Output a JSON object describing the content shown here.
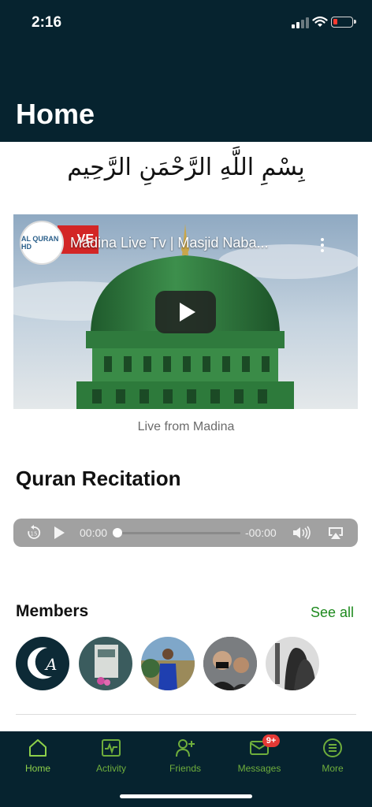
{
  "status_bar": {
    "time": "2:16",
    "battery_color": "#ff3b30"
  },
  "header": {
    "title": "Home",
    "background": "#06232f"
  },
  "bismillah": "بِسْمِ اللَّهِ الرَّحْمَنِ الرَّحِيم",
  "video": {
    "title": "Madina Live Tv | Masjid Naba...",
    "live_badge": "VE",
    "channel_logo_text": "AL QURAN HD",
    "caption": "Live from Madina"
  },
  "recitation": {
    "title": "Quran Recitation",
    "elapsed": "00:00",
    "remaining": "-00:00",
    "progress": 0
  },
  "members": {
    "title": "Members",
    "see_all": "See all",
    "accent": "#1e8a1e",
    "avatars": [
      "member-1",
      "member-2",
      "member-3",
      "member-4",
      "member-5"
    ]
  },
  "tabbar": {
    "tabs": [
      {
        "label": "Home",
        "icon": "home-icon"
      },
      {
        "label": "Activity",
        "icon": "activity-icon"
      },
      {
        "label": "Friends",
        "icon": "friends-icon"
      },
      {
        "label": "Messages",
        "icon": "messages-icon",
        "badge": "9+"
      },
      {
        "label": "More",
        "icon": "more-icon"
      }
    ],
    "active_color": "#6fae3c"
  }
}
